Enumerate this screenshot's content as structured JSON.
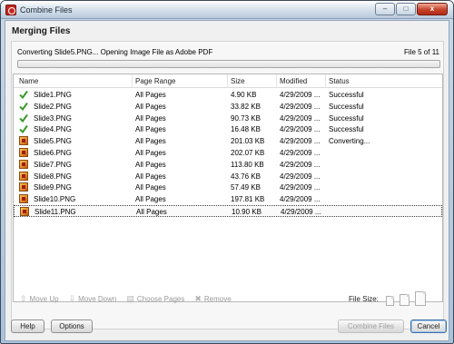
{
  "window": {
    "title": "Combine Files",
    "minimize": "–",
    "maximize": "□",
    "close": "x"
  },
  "heading": "Merging Files",
  "status": {
    "message": "Converting Slide5.PNG... Opening Image File as Adobe PDF",
    "file_count": "File 5 of 11",
    "progress_fraction": 0.0
  },
  "table": {
    "columns": [
      "Name",
      "Page Range",
      "Size",
      "Modified",
      "Status"
    ],
    "rows": [
      {
        "name": "Slide1.PNG",
        "range": "All Pages",
        "size": "4.90 KB",
        "modified": "4/29/2009 ...",
        "status": "Successful",
        "icon": "check-icon"
      },
      {
        "name": "Slide2.PNG",
        "range": "All Pages",
        "size": "33.82 KB",
        "modified": "4/29/2009 ...",
        "status": "Successful",
        "icon": "check-icon"
      },
      {
        "name": "Slide3.PNG",
        "range": "All Pages",
        "size": "90.73 KB",
        "modified": "4/29/2009 ...",
        "status": "Successful",
        "icon": "check-icon"
      },
      {
        "name": "Slide4.PNG",
        "range": "All Pages",
        "size": "16.48 KB",
        "modified": "4/29/2009 ...",
        "status": "Successful",
        "icon": "check-icon"
      },
      {
        "name": "Slide5.PNG",
        "range": "All Pages",
        "size": "201.03 KB",
        "modified": "4/29/2009 ...",
        "status": "Converting...",
        "icon": "image-file-icon"
      },
      {
        "name": "Slide6.PNG",
        "range": "All Pages",
        "size": "202.07 KB",
        "modified": "4/29/2009 ...",
        "status": "",
        "icon": "image-file-icon"
      },
      {
        "name": "Slide7.PNG",
        "range": "All Pages",
        "size": "113.80 KB",
        "modified": "4/29/2009 ...",
        "status": "",
        "icon": "image-file-icon"
      },
      {
        "name": "Slide8.PNG",
        "range": "All Pages",
        "size": "43.76 KB",
        "modified": "4/29/2009 ...",
        "status": "",
        "icon": "image-file-icon"
      },
      {
        "name": "Slide9.PNG",
        "range": "All Pages",
        "size": "57.49 KB",
        "modified": "4/29/2009 ...",
        "status": "",
        "icon": "image-file-icon"
      },
      {
        "name": "Slide10.PNG",
        "range": "All Pages",
        "size": "197.81 KB",
        "modified": "4/29/2009 ...",
        "status": "",
        "icon": "image-file-icon"
      },
      {
        "name": "Slide11.PNG",
        "range": "All Pages",
        "size": "10.90 KB",
        "modified": "4/29/2009 ...",
        "status": "",
        "icon": "image-file-icon"
      }
    ]
  },
  "actions": {
    "move_up": "Move Up",
    "move_down": "Move Down",
    "choose_pages": "Choose Pages",
    "remove": "Remove"
  },
  "file_size_label": "File Size:",
  "buttons": {
    "help": "Help",
    "options": "Options",
    "combine": "Combine Files",
    "cancel": "Cancel"
  },
  "colors": {
    "check": "#3a9a2a",
    "accent": "#3b6fa8"
  }
}
